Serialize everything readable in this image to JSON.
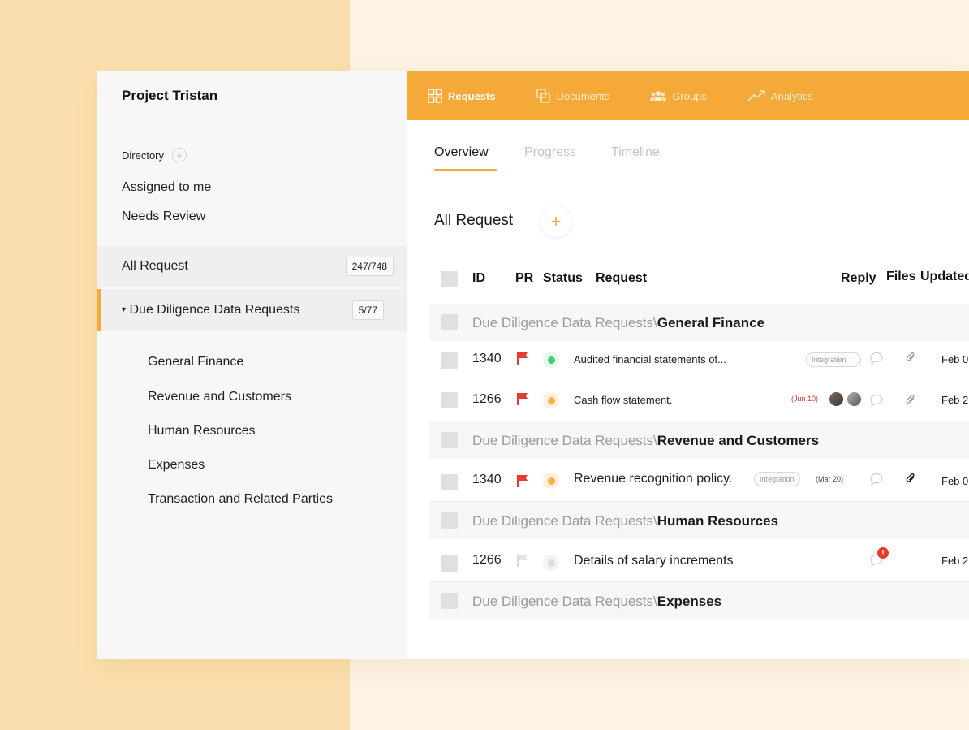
{
  "sidebar": {
    "project_title": "Project Tristan",
    "directory_label": "Directory",
    "directory_add": "+",
    "links": [
      "Assigned to me",
      "Needs Review"
    ],
    "all_request": {
      "label": "All Request",
      "count": "247/748"
    },
    "due_diligence": {
      "label": "Due Diligence Data Requests",
      "count": "5/77",
      "caret": "▾"
    },
    "sub_items": [
      "General Finance",
      "Revenue and Customers",
      "Human Resources",
      "Expenses",
      "Transaction and Related Parties"
    ]
  },
  "topnav": {
    "items": [
      {
        "label": "Requests",
        "icon": "grid-icon",
        "active": true
      },
      {
        "label": "Documents",
        "icon": "documents-icon",
        "active": false
      },
      {
        "label": "Groups",
        "icon": "groups-icon",
        "active": false
      },
      {
        "label": "Analytics",
        "icon": "analytics-icon",
        "active": false
      }
    ],
    "accent": "#f4a938"
  },
  "tabs": [
    {
      "label": "Overview",
      "active": true
    },
    {
      "label": "Progress",
      "active": false
    },
    {
      "label": "Timeline",
      "active": false
    }
  ],
  "main": {
    "title": "All Request",
    "add_label": "+"
  },
  "table": {
    "headers": {
      "id": "ID",
      "pr": "PR",
      "status": "Status",
      "request": "Request",
      "reply": "Reply",
      "files": "Files",
      "updated": "Updated"
    },
    "group_prefix": "Due Diligence Data Requests",
    "group_sep": "\\",
    "groups": [
      {
        "name": "General Finance"
      },
      {
        "name": "Revenue and Customers"
      },
      {
        "name": "Human Resources"
      },
      {
        "name": "Expenses"
      }
    ],
    "rows": [
      {
        "id": "1340",
        "flag": "red",
        "status": "green",
        "request": "Audited financial statements of...",
        "tag": "Integration",
        "updated": "Feb 0"
      },
      {
        "id": "1266",
        "flag": "red",
        "status": "orange",
        "request": "Cash flow statement.",
        "due": "(Jun 10)",
        "updated": "Feb 2"
      },
      {
        "id": "1340",
        "flag": "red",
        "status": "orange",
        "request": "Revenue recognition policy.",
        "tag": "Integration",
        "due": "(Mar 20)",
        "updated": "Feb 0"
      },
      {
        "id": "1266",
        "flag": "grey",
        "status": "grey",
        "request": "Details of salary increments",
        "alert": "!",
        "updated": "Feb 2"
      }
    ]
  },
  "colors": {
    "flag_red": "#e63b2e",
    "status_green": "#3ecf6e",
    "status_orange": "#f6b443",
    "status_grey": "#dcdcdc",
    "due_red": "#d33b2e"
  }
}
